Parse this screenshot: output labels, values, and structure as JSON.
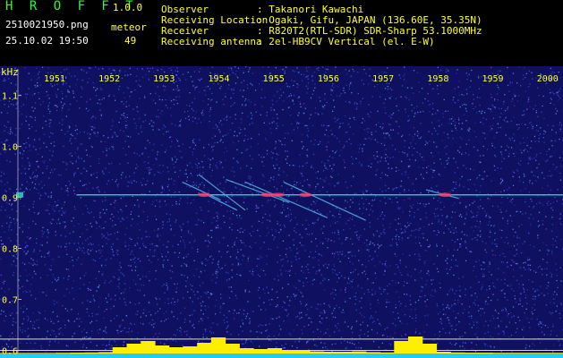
{
  "header": {
    "app_title": "H R O F F T",
    "version": "1.0.0",
    "filename": "2510021950.png",
    "datetime": "25.10.02 19:50",
    "mode_label": "meteor",
    "meteor_count": "49",
    "info_labels": [
      "Observer",
      "Receiving Location",
      "Receiver",
      "Receiving antenna"
    ],
    "info_values": [
      ": Takanori Kawachi",
      ": Ogaki, Gifu, JAPAN (136.60E, 35.35N)",
      ": R820T2(RTL-SDR) SDR-Sharp 53.1000MHz",
      ": 2el-HB9CV Vertical (el. E-W)"
    ]
  },
  "colors": {
    "header_green": "#22ff33",
    "header_yellow": "#ffff33",
    "axis_text": "#ffff33",
    "background_noise": "#101060",
    "carrier_line": "#33dddd",
    "bottom_bar_yellow": "#ffee00",
    "bottom_bar_cyan": "#22ccff"
  },
  "chart_data": {
    "type": "heatmap",
    "ylabel": "kHz",
    "y_ticks": [
      "1.1",
      "1.0",
      "0.9",
      "0.8",
      "0.7",
      "0.6"
    ],
    "y_tick_values": [
      1.1,
      1.0,
      0.9,
      0.8,
      0.7,
      0.6
    ],
    "ylim": [
      0.585,
      1.145
    ],
    "x_ticks": [
      "1951",
      "1952",
      "1953",
      "1954",
      "1955",
      "1956",
      "1957",
      "1958",
      "1959",
      "2000"
    ],
    "x_tick_minutes": [
      1,
      2,
      3,
      4,
      5,
      6,
      7,
      8,
      9,
      10
    ],
    "xlim": [
      0.25,
      10.2
    ],
    "carrier_khz": 0.905,
    "carrier_start_minute": 1.32,
    "meteor_echoes": [
      {
        "start_minute": 3.25,
        "end_minute": 3.95,
        "start_khz": 0.93,
        "end_khz": 0.895
      },
      {
        "start_minute": 3.55,
        "end_minute": 4.4,
        "start_khz": 0.945,
        "end_khz": 0.875
      },
      {
        "start_minute": 4.05,
        "end_minute": 5.2,
        "start_khz": 0.935,
        "end_khz": 0.89
      },
      {
        "start_minute": 4.4,
        "end_minute": 5.9,
        "start_khz": 0.93,
        "end_khz": 0.86
      },
      {
        "start_minute": 5.1,
        "end_minute": 6.6,
        "start_khz": 0.93,
        "end_khz": 0.855
      },
      {
        "start_minute": 3.7,
        "end_minute": 4.25,
        "start_khz": 0.905,
        "end_khz": 0.875
      },
      {
        "start_minute": 7.7,
        "end_minute": 8.3,
        "start_khz": 0.915,
        "end_khz": 0.898
      }
    ],
    "echo_bright_spots": [
      3.65,
      4.8,
      5.0,
      5.5,
      8.05
    ],
    "bottom_band_level": [
      0.03,
      0.03,
      0.03,
      0.03,
      0.04,
      0.05,
      0.06,
      0.08,
      0.35,
      0.55,
      0.7,
      0.45,
      0.35,
      0.4,
      0.6,
      0.9,
      0.55,
      0.3,
      0.25,
      0.3,
      0.2,
      0.15,
      0.12,
      0.1,
      0.1,
      0.12,
      0.08,
      0.06,
      0.7,
      0.95,
      0.55,
      0.1,
      0.06,
      0.05,
      0.05,
      0.04,
      0.04,
      0.04,
      0.04,
      0.04
    ]
  }
}
